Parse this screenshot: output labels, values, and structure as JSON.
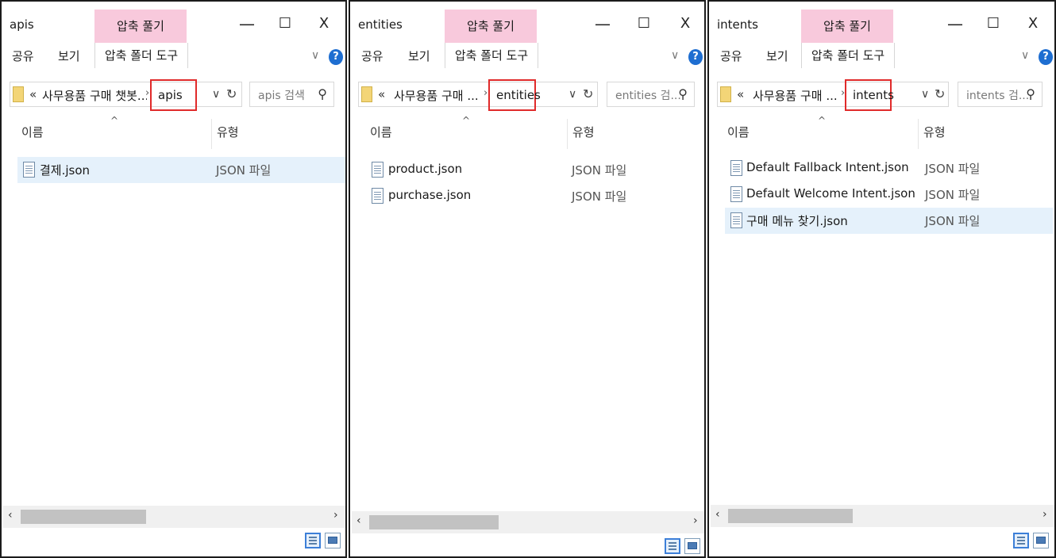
{
  "windows": [
    {
      "title": "apis",
      "context_tab": "압축 풀기",
      "ribbon_tabs": [
        "공유",
        "보기"
      ],
      "tool_tab": "압축 폴더 도구",
      "breadcrumb_chevron": "«",
      "breadcrumb_path": "사무용품 구매 챗봇...",
      "current_folder": "apis",
      "search_placeholder": "apis 검색",
      "col_name": "이름",
      "col_type": "유형",
      "files": [
        {
          "name": "결제.json",
          "type": "JSON 파일",
          "selected": true
        }
      ]
    },
    {
      "title": "entities",
      "context_tab": "압축 풀기",
      "ribbon_tabs": [
        "공유",
        "보기"
      ],
      "tool_tab": "압축 폴더 도구",
      "breadcrumb_chevron": "«",
      "breadcrumb_path": "사무용품 구매 ...",
      "current_folder": "entities",
      "search_placeholder": "entities 검...",
      "col_name": "이름",
      "col_type": "유형",
      "files": [
        {
          "name": "product.json",
          "type": "JSON 파일",
          "selected": false
        },
        {
          "name": "purchase.json",
          "type": "JSON 파일",
          "selected": false
        }
      ]
    },
    {
      "title": "intents",
      "context_tab": "압축 풀기",
      "ribbon_tabs": [
        "공유",
        "보기"
      ],
      "tool_tab": "압축 폴더 도구",
      "breadcrumb_chevron": "«",
      "breadcrumb_path": "사무용품 구매 ...",
      "current_folder": "intents",
      "search_placeholder": "intents 검...",
      "col_name": "이름",
      "col_type": "유형",
      "files": [
        {
          "name": "Default Fallback Intent.json",
          "type": "JSON 파일",
          "selected": false
        },
        {
          "name": "Default Welcome Intent.json",
          "type": "JSON 파일",
          "selected": false
        },
        {
          "name": "구매 메뉴 찾기.json",
          "type": "JSON 파일",
          "selected": true
        }
      ]
    }
  ],
  "controls": {
    "minimize": "—",
    "maximize": "☐",
    "close": "X",
    "help": "?",
    "ribbon_chevron": "∨",
    "dropdown": "∨",
    "refresh": "↻",
    "search_icon": "⚲",
    "sort_caret": "^",
    "scroll_left": "‹",
    "scroll_right": "›",
    "crumb_sep": "›"
  },
  "colors": {
    "context_tab_bg": "#f8c9dc",
    "highlight_border": "#e02a2a",
    "selection_bg": "#e5f1fb",
    "help_bg": "#1e6ed1"
  }
}
